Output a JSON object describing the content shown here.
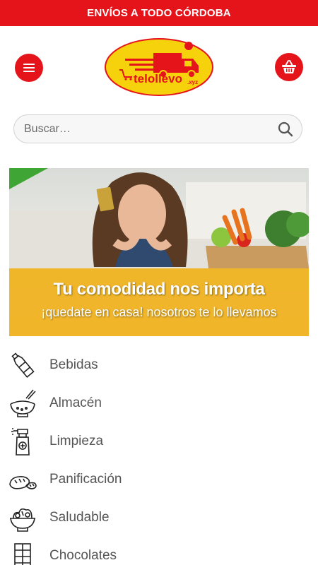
{
  "announcement": "ENVÍOS A TODO CÓRDOBA",
  "header": {
    "menu_icon": "menu-icon",
    "cart_icon": "basket-icon",
    "logo_text": "telollevo",
    "logo_suffix": ".xyz"
  },
  "search": {
    "placeholder": "Buscar…",
    "icon": "search-icon"
  },
  "banner": {
    "title": "Tu comodidad nos importa",
    "subtitle": "¡quedate en casa! nosotros te lo llevamos"
  },
  "categories": [
    {
      "label": "Bebidas",
      "icon": "bottle-icon"
    },
    {
      "label": "Almacén",
      "icon": "bowl-icon"
    },
    {
      "label": "Limpieza",
      "icon": "spray-bottle-icon"
    },
    {
      "label": "Panificación",
      "icon": "bread-icon"
    },
    {
      "label": "Saludable",
      "icon": "salad-icon"
    },
    {
      "label": "Chocolates",
      "icon": "chocolate-bar-icon"
    }
  ],
  "colors": {
    "brand_red": "#e5141b",
    "logo_yellow": "#f6d20d",
    "banner_yellow": "#f0b11a"
  }
}
